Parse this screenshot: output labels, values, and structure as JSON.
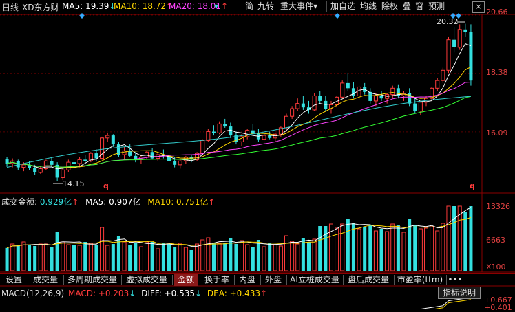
{
  "header": {
    "period": "日线",
    "stock_name": "XD东方财",
    "ma5": "MA5: 19.39",
    "ma5_arrow": "↓",
    "ma10": "MA10: 18.72",
    "ma10_arrow": "↑",
    "ma20": "MA20: 18.01",
    "ma20_arrow": "↑"
  },
  "toolbar": {
    "buttons": [
      "简",
      "九转",
      "重大事件",
      "加自选",
      "均线",
      "除权",
      "叠",
      "窗",
      "预测"
    ],
    "dropdown_glyph": "▾",
    "close": "×"
  },
  "price_axis": {
    "ticks": [
      "20.66",
      "18.38",
      "16.09"
    ],
    "high_label": "20.32",
    "low_label": "14.15",
    "marker": "q"
  },
  "volume_panel": {
    "title": "成交金额: ",
    "value": "0.929亿",
    "value_arrow": "↑",
    "ma5": "MA5: 0.907亿",
    "ma10": "MA10: 0.751亿",
    "ma10_arrow": "↑",
    "axis": [
      "13326",
      "6663",
      "X100"
    ]
  },
  "tabs": [
    "设置",
    "成交量",
    "多周期成交量",
    "虚拟成交量",
    "金额",
    "换手率",
    "内盘",
    "外盘",
    "AI立桩成交量",
    "盘后成交量",
    "市盈率(ttm)",
    "•••"
  ],
  "active_tab": "金额",
  "macd": {
    "title": "MACD(12,26,9)",
    "macd": "MACD: +0.203",
    "macd_arrow": "↓",
    "diff": "DIFF: +0.535",
    "diff_arrow": "↓",
    "dea": "DEA: +0.433",
    "dea_arrow": "↑",
    "help": "指标说明",
    "axis_top": "+0.667",
    "axis_2": "+0.401"
  },
  "colors": {
    "up": "#ff3b3b",
    "down": "#33e0e0",
    "ma5": "#ffffff",
    "ma10": "#ffd700",
    "ma20": "#ff44ff",
    "ma60": "#33ff33",
    "ma120": "#33cccc"
  },
  "chart_data": {
    "type": "candlestick",
    "ylim": [
      14.15,
      20.66
    ],
    "ohlc": [
      [
        15.02,
        15.1,
        14.72,
        14.85
      ],
      [
        14.85,
        15.05,
        14.7,
        14.95
      ],
      [
        14.95,
        15.0,
        14.6,
        14.7
      ],
      [
        14.7,
        14.9,
        14.55,
        14.8
      ],
      [
        14.8,
        14.95,
        14.6,
        14.68
      ],
      [
        14.68,
        14.8,
        14.4,
        14.5
      ],
      [
        14.5,
        14.75,
        14.45,
        14.65
      ],
      [
        14.65,
        15.0,
        14.6,
        14.95
      ],
      [
        14.95,
        15.1,
        14.7,
        14.8
      ],
      [
        14.8,
        14.9,
        14.15,
        14.3
      ],
      [
        14.3,
        14.7,
        14.2,
        14.6
      ],
      [
        14.6,
        15.0,
        14.5,
        14.9
      ],
      [
        14.9,
        15.05,
        14.75,
        14.85
      ],
      [
        14.85,
        15.1,
        14.7,
        15.0
      ],
      [
        15.0,
        15.2,
        14.85,
        14.95
      ],
      [
        14.95,
        15.3,
        14.9,
        15.25
      ],
      [
        15.25,
        15.4,
        14.95,
        15.05
      ],
      [
        15.05,
        15.9,
        15.0,
        15.85
      ],
      [
        15.85,
        16.05,
        15.7,
        15.95
      ],
      [
        15.95,
        16.0,
        15.5,
        15.6
      ],
      [
        15.6,
        15.7,
        15.1,
        15.2
      ],
      [
        15.2,
        15.5,
        15.0,
        15.35
      ],
      [
        15.35,
        15.6,
        15.1,
        15.15
      ],
      [
        15.15,
        15.3,
        14.9,
        15.0
      ],
      [
        15.0,
        15.2,
        14.85,
        15.1
      ],
      [
        15.1,
        15.35,
        15.0,
        15.3
      ],
      [
        15.3,
        15.45,
        15.0,
        15.05
      ],
      [
        15.05,
        15.25,
        14.95,
        15.2
      ],
      [
        15.2,
        15.4,
        15.05,
        15.15
      ],
      [
        15.15,
        15.3,
        14.9,
        14.95
      ],
      [
        14.95,
        15.1,
        14.7,
        14.8
      ],
      [
        14.8,
        15.0,
        14.65,
        14.95
      ],
      [
        14.95,
        15.15,
        14.85,
        15.1
      ],
      [
        15.1,
        15.2,
        14.9,
        15.0
      ],
      [
        15.0,
        15.3,
        14.95,
        15.25
      ],
      [
        15.25,
        15.8,
        15.2,
        15.75
      ],
      [
        15.75,
        16.2,
        15.7,
        16.1
      ],
      [
        16.1,
        16.35,
        15.95,
        16.05
      ],
      [
        16.05,
        16.5,
        16.0,
        16.4
      ],
      [
        16.4,
        16.6,
        16.25,
        16.3
      ],
      [
        16.3,
        16.45,
        15.85,
        15.95
      ],
      [
        15.95,
        16.1,
        15.6,
        15.7
      ],
      [
        15.7,
        16.0,
        15.55,
        15.9
      ],
      [
        15.9,
        16.2,
        15.8,
        16.15
      ],
      [
        16.15,
        16.4,
        16.0,
        16.05
      ],
      [
        16.05,
        16.2,
        15.7,
        15.8
      ],
      [
        15.8,
        16.0,
        15.65,
        15.95
      ],
      [
        15.95,
        16.1,
        15.8,
        15.85
      ],
      [
        15.85,
        16.05,
        15.7,
        16.0
      ],
      [
        16.0,
        16.3,
        15.9,
        16.25
      ],
      [
        16.25,
        16.8,
        16.2,
        16.7
      ],
      [
        16.7,
        17.1,
        16.6,
        17.0
      ],
      [
        17.0,
        17.4,
        16.9,
        17.2
      ],
      [
        17.2,
        17.5,
        16.95,
        17.05
      ],
      [
        17.05,
        17.3,
        16.8,
        16.95
      ],
      [
        16.95,
        17.6,
        16.9,
        17.5
      ],
      [
        17.5,
        17.7,
        17.2,
        17.3
      ],
      [
        17.3,
        17.5,
        16.9,
        17.0
      ],
      [
        17.0,
        17.3,
        16.8,
        17.15
      ],
      [
        17.15,
        17.5,
        17.05,
        17.45
      ],
      [
        17.45,
        18.1,
        17.4,
        18.0
      ],
      [
        18.0,
        18.4,
        17.7,
        17.8
      ],
      [
        17.8,
        18.05,
        17.4,
        17.5
      ],
      [
        17.5,
        17.9,
        17.35,
        17.85
      ],
      [
        17.85,
        18.0,
        17.55,
        17.65
      ],
      [
        17.65,
        17.8,
        17.2,
        17.3
      ],
      [
        17.3,
        17.6,
        17.1,
        17.5
      ],
      [
        17.5,
        17.7,
        17.3,
        17.4
      ],
      [
        17.4,
        17.6,
        17.2,
        17.55
      ],
      [
        17.55,
        17.9,
        17.4,
        17.8
      ],
      [
        17.8,
        17.95,
        17.4,
        17.5
      ],
      [
        17.5,
        17.7,
        17.3,
        17.6
      ],
      [
        17.6,
        17.8,
        17.1,
        17.2
      ],
      [
        17.2,
        17.4,
        16.8,
        16.9
      ],
      [
        16.9,
        17.3,
        16.75,
        17.25
      ],
      [
        17.25,
        17.5,
        17.1,
        17.4
      ],
      [
        17.4,
        17.85,
        17.3,
        17.8
      ],
      [
        17.8,
        18.2,
        17.7,
        18.1
      ],
      [
        18.1,
        18.6,
        18.0,
        18.5
      ],
      [
        18.5,
        19.8,
        18.4,
        19.7
      ],
      [
        19.7,
        20.2,
        19.2,
        19.4
      ],
      [
        19.4,
        20.3,
        19.3,
        20.1
      ],
      [
        20.1,
        20.32,
        19.8,
        20.0
      ],
      [
        20.0,
        20.3,
        17.9,
        18.1
      ]
    ]
  }
}
